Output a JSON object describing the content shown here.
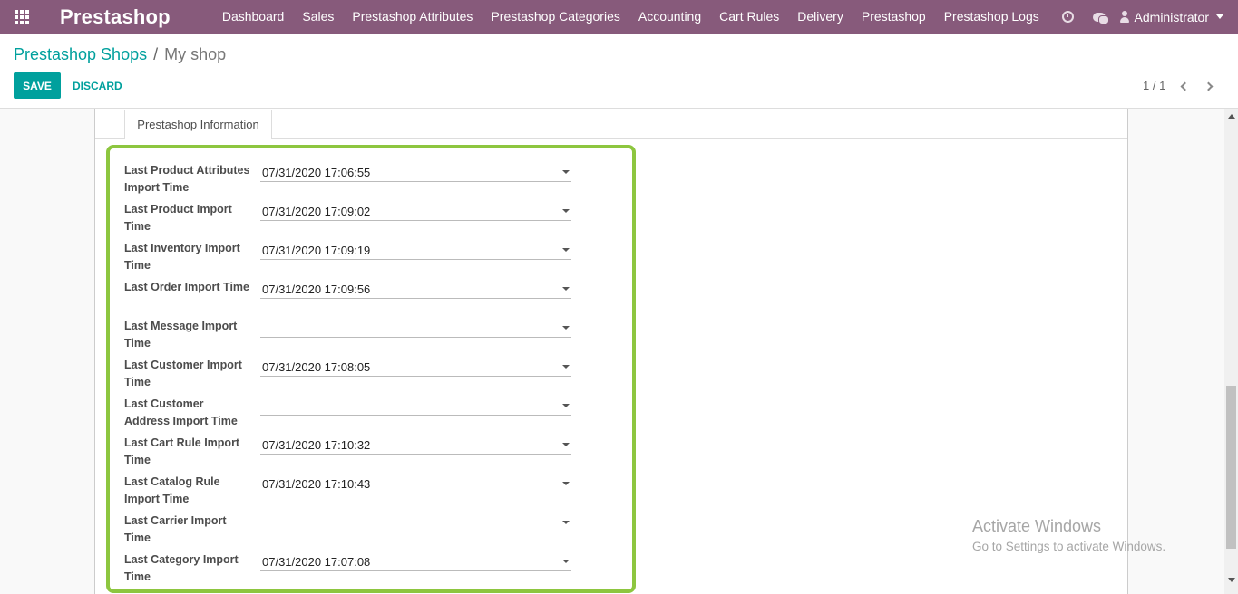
{
  "app": {
    "brand": "Prestashop"
  },
  "nav": {
    "menu": [
      {
        "label": "Dashboard"
      },
      {
        "label": "Sales"
      },
      {
        "label": "Prestashop Attributes"
      },
      {
        "label": "Prestashop Categories"
      },
      {
        "label": "Accounting"
      },
      {
        "label": "Cart Rules"
      },
      {
        "label": "Delivery"
      },
      {
        "label": "Prestashop"
      },
      {
        "label": "Prestashop Logs"
      }
    ],
    "user": "Administrator",
    "icons": [
      "apps-grid-icon",
      "clock-icon",
      "chat-icon",
      "user-icon",
      "caret-down-icon"
    ]
  },
  "breadcrumb": {
    "parent": "Prestashop Shops",
    "separator": "/",
    "current": "My shop"
  },
  "actions": {
    "save": "SAVE",
    "discard": "DISCARD"
  },
  "pager": {
    "value": "1 / 1"
  },
  "tab": {
    "label": "Prestashop Information"
  },
  "fields": [
    {
      "label": "Last Product Attributes Import Time",
      "value": "07/31/2020 17:06:55"
    },
    {
      "label": "Last Product Import Time",
      "value": "07/31/2020 17:09:02"
    },
    {
      "label": "Last Inventory Import Time",
      "value": "07/31/2020 17:09:19"
    },
    {
      "label": "Last Order Import Time",
      "value": "07/31/2020 17:09:56"
    },
    {
      "label": "Last Message Import Time",
      "value": ""
    },
    {
      "label": "Last Customer Import Time",
      "value": "07/31/2020 17:08:05"
    },
    {
      "label": "Last Customer Address Import Time",
      "value": ""
    },
    {
      "label": "Last Cart Rule Import Time",
      "value": "07/31/2020 17:10:32"
    },
    {
      "label": "Last Catalog Rule Import Time",
      "value": "07/31/2020 17:10:43"
    },
    {
      "label": "Last Carrier Import Time",
      "value": ""
    },
    {
      "label": "Last Category Import Time",
      "value": "07/31/2020 17:07:08"
    }
  ],
  "watermark": {
    "title": "Activate Windows",
    "subtitle": "Go to Settings to activate Windows."
  },
  "colors": {
    "navbar": "#875a7b",
    "accent": "#00a09d",
    "highlight": "#8dc63f"
  }
}
